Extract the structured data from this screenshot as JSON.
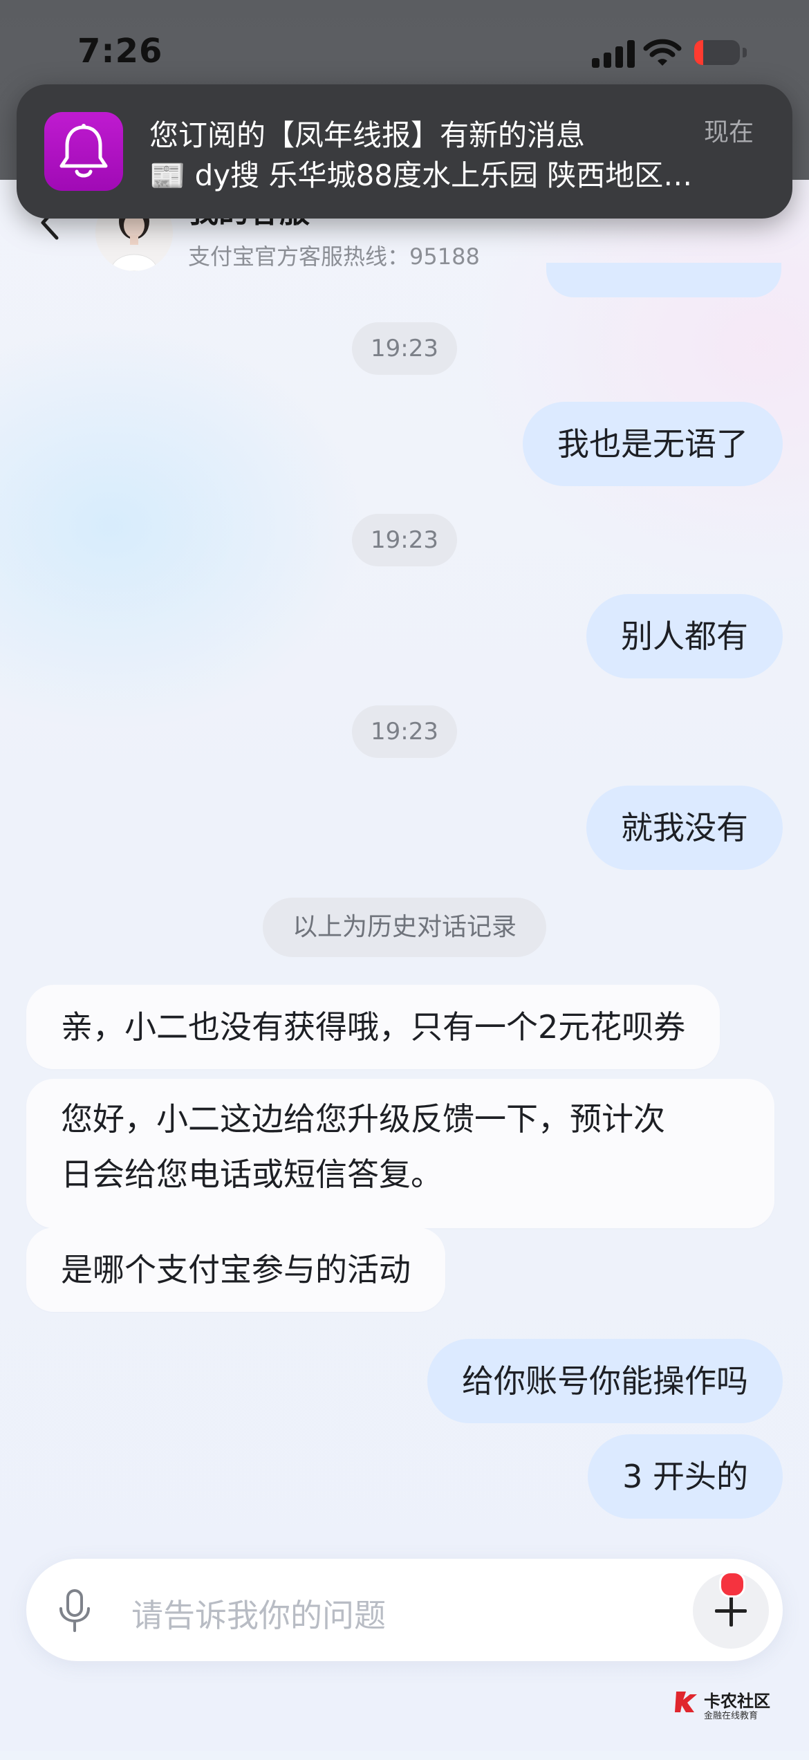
{
  "status_bar": {
    "time": "7:26",
    "battery_level": 0.2,
    "battery_color": "#ff3b30"
  },
  "notification": {
    "app_icon": "bell-icon",
    "icon_color": "#b012c4",
    "title": "您订阅的【凤年线报】有新的消息",
    "body": "📰 dy搜 乐华城88度水上乐园 陕西地区…",
    "time": "现在"
  },
  "header": {
    "back_icon": "chevron-left-icon",
    "agent_name": "我的客服",
    "hotline": "支付宝官方客服热线：95188"
  },
  "messages": {
    "ts1": "19:23",
    "m1": "我也是无语了",
    "ts2": "19:23",
    "m2": "别人都有",
    "ts3": "19:23",
    "m3": "就我没有",
    "history_divider": "以上为历史对话记录",
    "r1": "亲，小二也没有获得哦，只有一个2元花呗券",
    "r2_line1": "您好，小二这边给您升级反馈一下，预计次",
    "r2_line2": "日会给您电话或短信答复。",
    "r3": "是哪个支付宝参与的活动",
    "m4": "给你账号你能操作吗",
    "m5": "3 开头的"
  },
  "composer": {
    "mic_icon": "microphone-icon",
    "placeholder": "请告诉我你的问题",
    "plus_icon": "plus-icon",
    "badge_color": "#f5333f"
  },
  "watermark": {
    "title": "卡农社区",
    "subtitle": "金融在线教育"
  },
  "colors": {
    "user_bubble": "#dceaff",
    "agent_bubble": "#fbfbfd",
    "timestamp_pill": "#e6e8ee"
  }
}
